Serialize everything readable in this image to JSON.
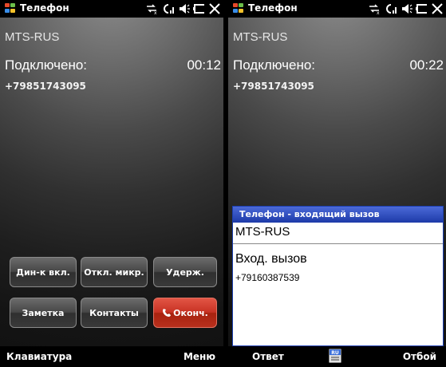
{
  "screens": [
    {
      "status": {
        "app_title": "Телефон"
      },
      "operator": "MTS-RUS",
      "call": {
        "state": "Подключено:",
        "timer": "00:12",
        "number": "+79851743095"
      },
      "buttons": {
        "speaker": "Дин-к вкл.",
        "mute": "Откл. микр.",
        "hold": "Удерж.",
        "note": "Заметка",
        "contacts": "Контакты",
        "end": "Оконч."
      },
      "softkeys": {
        "left": "Клавиатура",
        "right": "Меню"
      }
    },
    {
      "status": {
        "app_title": "Телефон"
      },
      "operator": "MTS-RUS",
      "call": {
        "state": "Подключено:",
        "timer": "00:22",
        "number": "+79851743095"
      },
      "incoming_dialog": {
        "title": "Телефон - входящий вызов",
        "operator": "MTS-RUS",
        "heading": "Вход. вызов",
        "number": "+79160387539"
      },
      "softkeys": {
        "left": "Ответ",
        "center_icon_label": "RU",
        "right": "Отбой"
      }
    }
  ],
  "colors": {
    "end_button": "#c83324",
    "dialog_title_bar": "#1d3aa8"
  },
  "icons": {
    "status": [
      "data-connection-icon",
      "signal-strength-icon",
      "volume-icon",
      "battery-icon",
      "close-icon"
    ],
    "windows_logo": "windows-flag-icon",
    "end_call": "phone-handset-icon",
    "keyboard": "keyboard-ru-icon"
  }
}
